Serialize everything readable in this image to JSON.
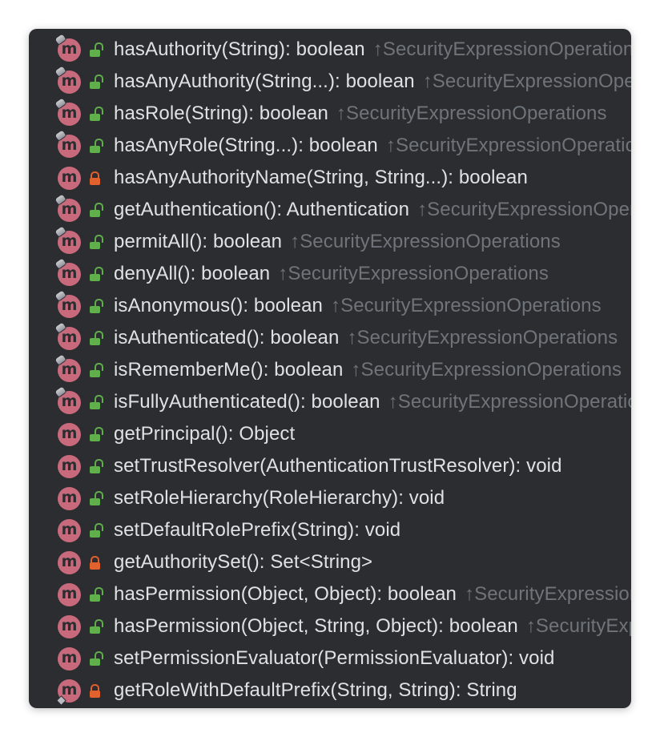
{
  "colors": {
    "panel_bg": "#2b2d30",
    "method_icon": "#c96a7c",
    "public_lock": "#5fb04b",
    "private_lock": "#e2612c",
    "signature_text": "#dfe1e5",
    "origin_text": "#6f737a"
  },
  "icon_letter": "m",
  "methods": [
    {
      "signature": "hasAuthority(String): boolean",
      "origin": "↑SecurityExpressionOperations",
      "visibility": "public",
      "inherited_pin": true,
      "diamond": false
    },
    {
      "signature": "hasAnyAuthority(String...): boolean",
      "origin": "↑SecurityExpressionOperations",
      "visibility": "public",
      "inherited_pin": true,
      "diamond": false
    },
    {
      "signature": "hasRole(String): boolean",
      "origin": "↑SecurityExpressionOperations",
      "visibility": "public",
      "inherited_pin": true,
      "diamond": false
    },
    {
      "signature": "hasAnyRole(String...): boolean",
      "origin": "↑SecurityExpressionOperations",
      "visibility": "public",
      "inherited_pin": true,
      "diamond": false
    },
    {
      "signature": "hasAnyAuthorityName(String, String...): boolean",
      "origin": "",
      "visibility": "private",
      "inherited_pin": false,
      "diamond": false
    },
    {
      "signature": "getAuthentication(): Authentication",
      "origin": "↑SecurityExpressionOperations",
      "visibility": "public",
      "inherited_pin": true,
      "diamond": false
    },
    {
      "signature": "permitAll(): boolean",
      "origin": "↑SecurityExpressionOperations",
      "visibility": "public",
      "inherited_pin": true,
      "diamond": false
    },
    {
      "signature": "denyAll(): boolean",
      "origin": "↑SecurityExpressionOperations",
      "visibility": "public",
      "inherited_pin": true,
      "diamond": false
    },
    {
      "signature": "isAnonymous(): boolean",
      "origin": "↑SecurityExpressionOperations",
      "visibility": "public",
      "inherited_pin": true,
      "diamond": false
    },
    {
      "signature": "isAuthenticated(): boolean",
      "origin": "↑SecurityExpressionOperations",
      "visibility": "public",
      "inherited_pin": true,
      "diamond": false
    },
    {
      "signature": "isRememberMe(): boolean",
      "origin": "↑SecurityExpressionOperations",
      "visibility": "public",
      "inherited_pin": true,
      "diamond": false
    },
    {
      "signature": "isFullyAuthenticated(): boolean",
      "origin": "↑SecurityExpressionOperations",
      "visibility": "public",
      "inherited_pin": true,
      "diamond": false
    },
    {
      "signature": "getPrincipal(): Object",
      "origin": "",
      "visibility": "public",
      "inherited_pin": false,
      "diamond": false
    },
    {
      "signature": "setTrustResolver(AuthenticationTrustResolver): void",
      "origin": "",
      "visibility": "public",
      "inherited_pin": false,
      "diamond": false
    },
    {
      "signature": "setRoleHierarchy(RoleHierarchy): void",
      "origin": "",
      "visibility": "public",
      "inherited_pin": false,
      "diamond": false
    },
    {
      "signature": "setDefaultRolePrefix(String): void",
      "origin": "",
      "visibility": "public",
      "inherited_pin": false,
      "diamond": false
    },
    {
      "signature": "getAuthoritySet(): Set<String>",
      "origin": "",
      "visibility": "private",
      "inherited_pin": false,
      "diamond": false
    },
    {
      "signature": "hasPermission(Object, Object): boolean",
      "origin": "↑SecurityExpressionOperations",
      "visibility": "public",
      "inherited_pin": false,
      "diamond": false
    },
    {
      "signature": "hasPermission(Object, String, Object): boolean",
      "origin": "↑SecurityExpressionOperations",
      "visibility": "public",
      "inherited_pin": false,
      "diamond": false
    },
    {
      "signature": "setPermissionEvaluator(PermissionEvaluator): void",
      "origin": "",
      "visibility": "public",
      "inherited_pin": false,
      "diamond": false
    },
    {
      "signature": "getRoleWithDefaultPrefix(String, String): String",
      "origin": "",
      "visibility": "private",
      "inherited_pin": false,
      "diamond": true
    }
  ]
}
